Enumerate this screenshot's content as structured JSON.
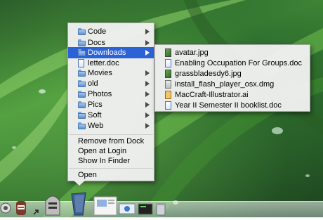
{
  "dock_menu": {
    "folders": [
      {
        "label": "Code",
        "has_submenu": true
      },
      {
        "label": "Docs",
        "has_submenu": true
      },
      {
        "label": "Downloads",
        "has_submenu": true,
        "highlighted": true
      },
      {
        "label": "letter.doc",
        "has_submenu": false
      },
      {
        "label": "Movies",
        "has_submenu": true
      },
      {
        "label": "old",
        "has_submenu": true
      },
      {
        "label": "Photos",
        "has_submenu": true
      },
      {
        "label": "Pics",
        "has_submenu": true
      },
      {
        "label": "Soft",
        "has_submenu": true
      },
      {
        "label": "Web",
        "has_submenu": true
      }
    ],
    "actions": [
      "Remove from Dock",
      "Open at Login",
      "Show In Finder"
    ],
    "open_label": "Open"
  },
  "downloads_submenu": {
    "items": [
      {
        "label": "avatar.jpg",
        "icon": "image-file-icon"
      },
      {
        "label": "Enabling Occupation For Groups.doc",
        "icon": "document-icon"
      },
      {
        "label": "grassbladesdy6.jpg",
        "icon": "image-file-icon"
      },
      {
        "label": "install_flash_player_osx.dmg",
        "icon": "disk-image-icon"
      },
      {
        "label": "MacCraft-Illustrator.ai",
        "icon": "illustrator-file-icon"
      },
      {
        "label": "Year II Semester II booklist.doc",
        "icon": "document-icon"
      }
    ]
  },
  "colors": {
    "highlight": "#2b62d6",
    "menu_bg": "#f0f0f0"
  }
}
